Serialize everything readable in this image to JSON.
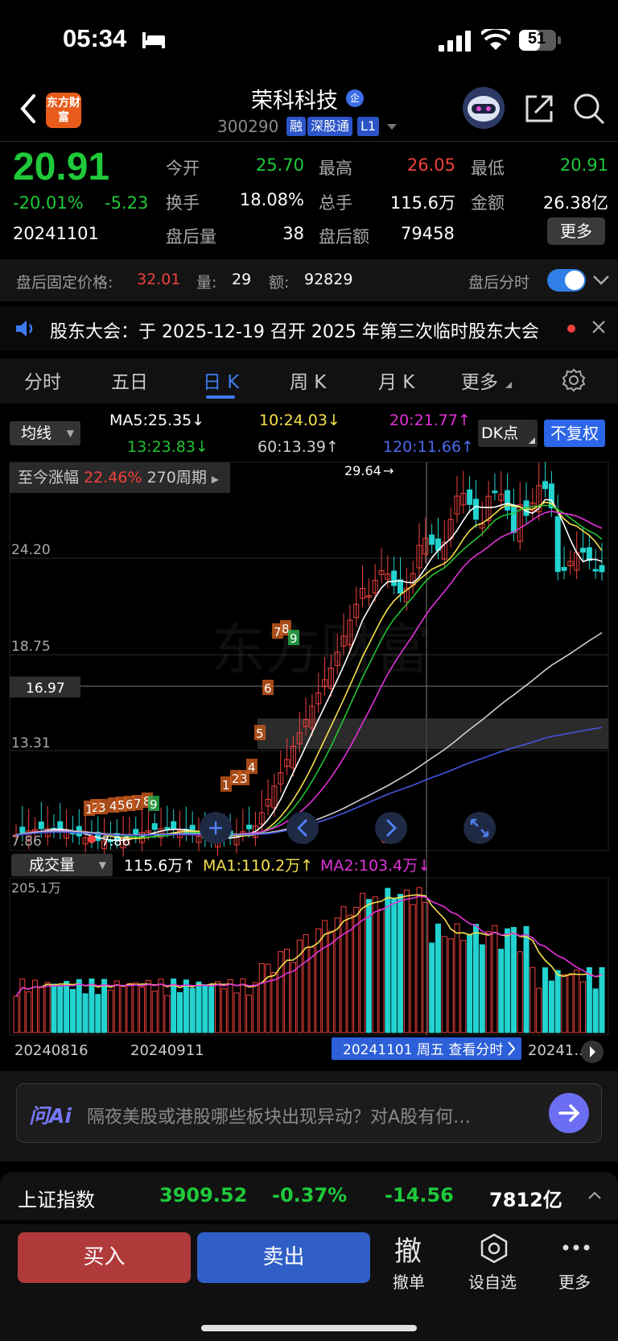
{
  "status": {
    "time": "05:34",
    "battery": "51"
  },
  "header": {
    "logo_text": "东方财富",
    "stock_name": "荣科科技",
    "name_badge": "企",
    "stock_code": "300290",
    "tags": [
      "融",
      "深股通",
      "L1"
    ]
  },
  "quote": {
    "price": "20.91",
    "change_pct": "-20.01%",
    "change": "-5.23",
    "date": "20241101",
    "open_label": "今开",
    "open": "25.70",
    "high_label": "最高",
    "high": "26.05",
    "low_label": "最低",
    "low": "20.91",
    "turnover_label": "换手",
    "turnover": "18.08%",
    "volume_label": "总手",
    "volume": "115.6万",
    "amount_label": "金额",
    "amount": "26.38亿",
    "ah_vol_label": "盘后量",
    "ah_vol": "38",
    "ah_amount_label": "盘后额",
    "ah_amount": "79458",
    "more_label": "更多"
  },
  "after_hours": {
    "price_label": "盘后固定价格:",
    "price": "32.01",
    "vol_label": "量:",
    "vol": "29",
    "amt_label": "额:",
    "amt": "92829",
    "toggle_label": "盘后分时"
  },
  "notice": {
    "text": "股东大会：于 2025-12-19 召开 2025 年第三次临时股东大会"
  },
  "tabs": [
    "分时",
    "五日",
    "日 K",
    "周 K",
    "月 K",
    "更多"
  ],
  "ma": {
    "selector": "均线",
    "ma5": "MA5:25.35↓",
    "ma10": "10:24.03↓",
    "ma20": "20:21.77↑",
    "ma13": "13:23.83↓",
    "ma60": "60:13.39↑",
    "ma120": "120:11.66↑",
    "dk_label": "DK点",
    "fq_label": "不复权",
    "colors": {
      "ma5": "#ffffff",
      "ma10": "#f5e14b",
      "ma20": "#e033d8",
      "ma13": "#22c232",
      "ma60": "#cfcfcf",
      "ma120": "#4257e0"
    }
  },
  "kline": {
    "since_label": "至今涨幅",
    "since_pct": "22.46%",
    "period": "270周期",
    "y_labels": [
      "24.20",
      "18.75",
      "13.31",
      "7.86"
    ],
    "crosshair_price": "16.97",
    "high_marker": "29.64",
    "low_marker": "7.86",
    "watermark": "东方财富",
    "td_numbers": [
      "1",
      "2",
      "3",
      "4",
      "5",
      "6",
      "7",
      "8",
      "9",
      "1",
      "2",
      "3",
      "4",
      "5",
      "6",
      "7",
      "8",
      "9"
    ]
  },
  "volume": {
    "selector": "成交量",
    "vol": "115.6万↑",
    "ma1": "MA1:110.2万↑",
    "ma2": "MA2:103.4万↓",
    "max_label": "205.1万",
    "dates": [
      "20240816",
      "20240911",
      "2024…",
      "20241…"
    ],
    "tooltip": "20241101 周五 查看分时"
  },
  "ai": {
    "logo": "问Ai",
    "placeholder": "隔夜美股或港股哪些板块出现异动？对A股有何…"
  },
  "index": {
    "name": "上证指数",
    "value": "3909.52",
    "pct": "-0.37%",
    "change": "-14.56",
    "amount": "7812亿"
  },
  "bottom": {
    "buy": "买入",
    "sell": "卖出",
    "cancel_glyph": "撤",
    "cancel": "撤单",
    "watchlist": "设自选",
    "more": "更多"
  }
}
